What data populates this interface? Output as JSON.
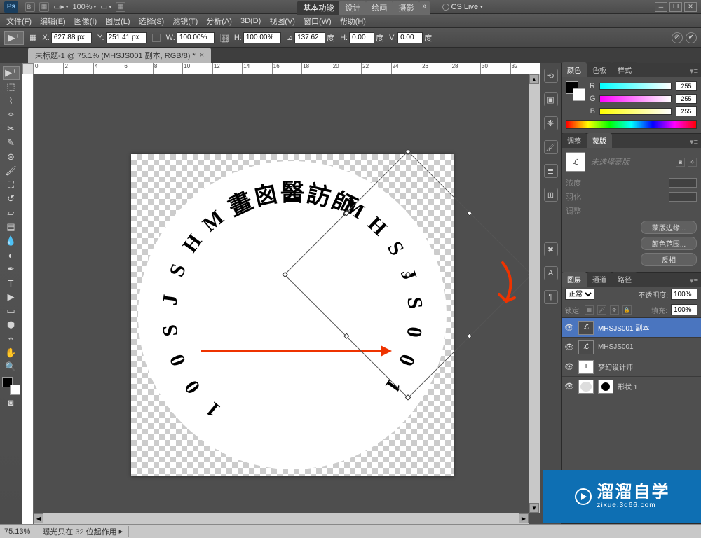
{
  "titlebar": {
    "zoom_dropdown": "100%",
    "workspace_tabs": [
      "基本功能",
      "设计",
      "绘画",
      "摄影"
    ],
    "cslive": "CS Live"
  },
  "menubar": [
    "文件(F)",
    "编辑(E)",
    "图像(I)",
    "图层(L)",
    "选择(S)",
    "滤镜(T)",
    "分析(A)",
    "3D(D)",
    "视图(V)",
    "窗口(W)",
    "帮助(H)"
  ],
  "options": {
    "x_label": "X:",
    "x": "627.88 px",
    "y_label": "Y:",
    "y": "251.41 px",
    "w_label": "W:",
    "w": "100.00%",
    "h_label": "H:",
    "h": "100.00%",
    "angle_label": "⊿",
    "angle": "137.62",
    "deg": "度",
    "hskew_label": "H:",
    "hskew": "0.00",
    "hdeg": "度",
    "vskew_label": "V:",
    "vskew": "0.00",
    "vdeg": "度"
  },
  "document_tab": "未标题-1 @ 75.1% (MHSJS001 副本, RGB/8) *",
  "ruler_ticks": [
    "0",
    "2",
    "4",
    "6",
    "8",
    "10",
    "12",
    "14",
    "16",
    "18",
    "20",
    "22",
    "24",
    "26",
    "28",
    "30",
    "32"
  ],
  "color_panel": {
    "tabs": [
      "颜色",
      "色板",
      "样式"
    ],
    "channels": [
      {
        "name": "R",
        "value": "255"
      },
      {
        "name": "G",
        "value": "255"
      },
      {
        "name": "B",
        "value": "255"
      }
    ]
  },
  "adjust_panel": {
    "tabs": [
      "调整",
      "蒙版"
    ],
    "mask_hint": "未选择蒙版",
    "density": "浓度",
    "feather": "羽化",
    "adjust": "调整",
    "btn_edge": "蒙版边缘...",
    "btn_range": "颜色范围...",
    "btn_invert": "反相"
  },
  "layers_panel": {
    "tabs": [
      "图层",
      "通道",
      "路径"
    ],
    "blend": "正常",
    "opacity_label": "不透明度:",
    "opacity": "100%",
    "lock_label": "锁定:",
    "fill_label": "填充:",
    "fill": "100%",
    "layers": [
      {
        "name": "MHSJS001 副本",
        "thumb": "text",
        "selected": true
      },
      {
        "name": "MHSJS001",
        "thumb": "text",
        "selected": false
      },
      {
        "name": "梦幻设计师",
        "thumb": "T",
        "selected": false
      },
      {
        "name": "形状 1",
        "thumb": "shape",
        "selected": false
      }
    ]
  },
  "statusbar": {
    "zoom": "75.13%",
    "info": "曝光只在 32 位起作用"
  },
  "watermark": {
    "big": "溜溜自学",
    "small": "zixue.3d66.com"
  },
  "arc_text_left": "MHSJS001",
  "arc_text_mid": "畫囪醫訪師",
  "arc_text_right": "MHSJS001"
}
